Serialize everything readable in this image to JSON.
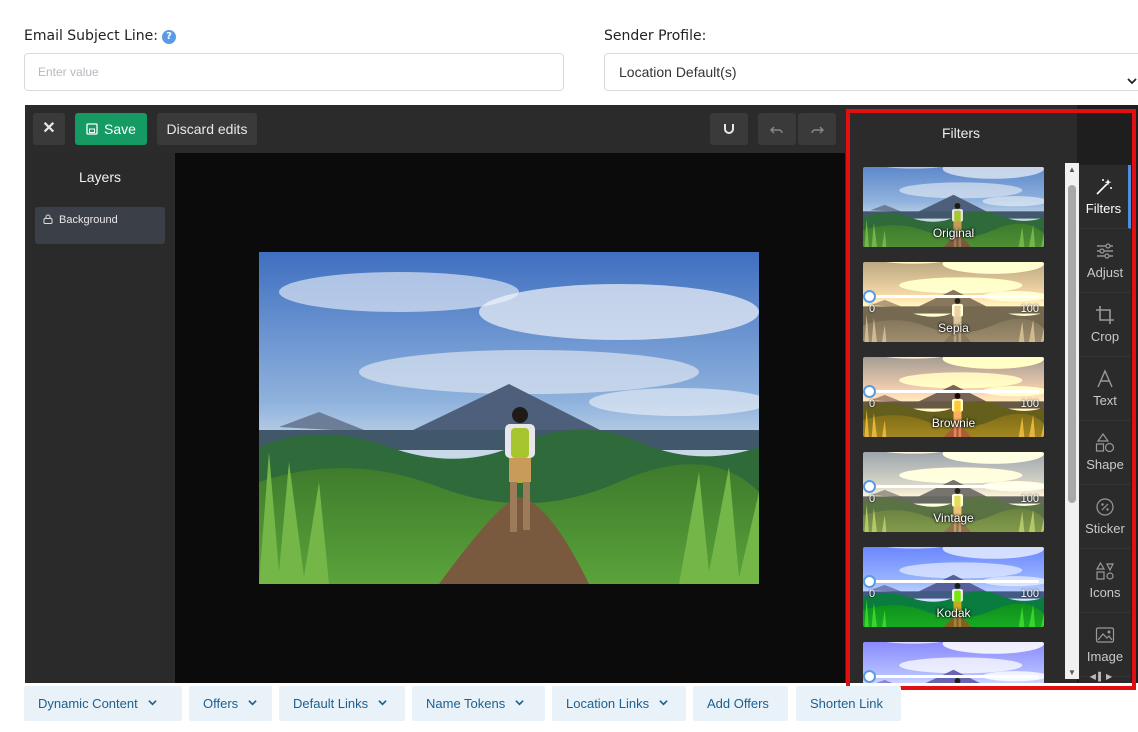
{
  "form": {
    "subject_label": "Email Subject Line:",
    "help_icon": "?",
    "subject_placeholder": "Enter value",
    "sender_label": "Sender Profile:",
    "sender_value": "Location Default(s)",
    "select_chevron": "⌄"
  },
  "toolbar": {
    "close": "✕",
    "save": "Save",
    "discard": "Discard edits"
  },
  "layers": {
    "title": "Layers",
    "items": [
      "Background"
    ]
  },
  "filters": {
    "title": "Filters",
    "thumbs": [
      {
        "label": "Original"
      },
      {
        "label": "Sepia",
        "min": "0",
        "max": "100",
        "level": 0
      },
      {
        "label": "Brownie",
        "min": "0",
        "max": "100",
        "level": 0
      },
      {
        "label": "Vintage",
        "min": "0",
        "max": "100",
        "level": 0
      },
      {
        "label": "Kodak",
        "min": "0",
        "max": "100",
        "level": 0
      },
      {
        "label": ""
      }
    ]
  },
  "side_tabs": [
    {
      "label": "Filters",
      "icon": "magic-wand-icon",
      "active": true
    },
    {
      "label": "Adjust",
      "icon": "sliders-icon"
    },
    {
      "label": "Crop",
      "icon": "crop-icon"
    },
    {
      "label": "Text",
      "icon": "text-icon"
    },
    {
      "label": "Shape",
      "icon": "shape-icon"
    },
    {
      "label": "Sticker",
      "icon": "sticker-icon"
    },
    {
      "label": "Icons",
      "icon": "icons-icon"
    },
    {
      "label": "Image",
      "icon": "image-icon"
    }
  ],
  "bottom_bar": {
    "dynamic_content": "Dynamic Content",
    "offers": "Offers",
    "default_links": "Default Links",
    "name_tokens": "Name Tokens",
    "location_links": "Location Links",
    "add_offers": "Add Offers",
    "shorten_link": "Shorten Link"
  },
  "colors": {
    "save_green": "#159a63",
    "highlight_red": "#e10f12",
    "link_blue": "#1d5f8f",
    "active_tab_blue": "#4a90e2"
  }
}
